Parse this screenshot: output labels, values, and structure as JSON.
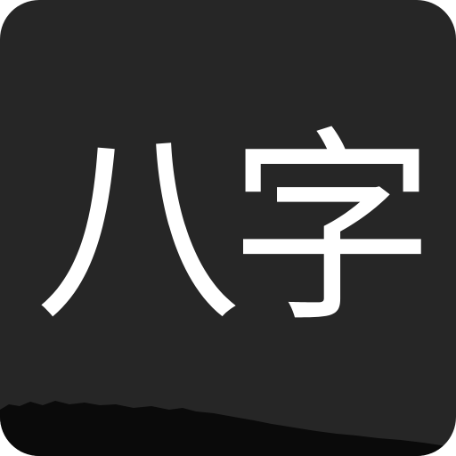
{
  "icon": {
    "title": "八字",
    "colors": {
      "background": "#262626",
      "text": "#ffffff",
      "mountain": "#0a0a0a"
    }
  }
}
